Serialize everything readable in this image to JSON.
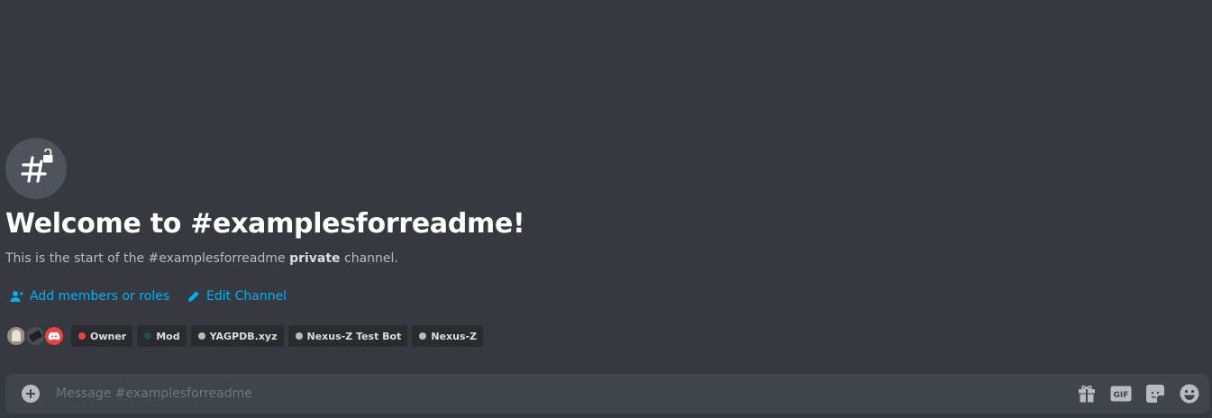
{
  "welcome": {
    "channel_icon": "hashtag-lock-icon",
    "title": "Welcome to #examplesforreadme!",
    "desc_prefix": "This is the start of the #examplesforreadme ",
    "desc_bold": "private",
    "desc_suffix": " channel."
  },
  "actions": {
    "add_members_label": "Add members or roles",
    "add_members_icon": "person-add-icon",
    "edit_channel_label": "Edit Channel",
    "edit_channel_icon": "pencil-icon"
  },
  "members": {
    "avatars": [
      "user-avatar",
      "user-avatar",
      "discord-logo-avatar"
    ],
    "roles": [
      {
        "name": "Owner",
        "color": "#ed4245"
      },
      {
        "name": "Mod",
        "color": "#1f4d58"
      },
      {
        "name": "YAGPDB.xyz",
        "color": "#b9bbbe"
      },
      {
        "name": "Nexus-Z Test Bot",
        "color": "#b9bbbe"
      },
      {
        "name": "Nexus-Z",
        "color": "#b9bbbe"
      }
    ]
  },
  "composer": {
    "placeholder": "Message #examplesforreadme",
    "value": "",
    "attach_icon": "plus-circle-icon",
    "buttons": [
      "gift-icon",
      "gif-icon",
      "sticker-icon",
      "emoji-icon"
    ]
  },
  "colors": {
    "background": "#36393f",
    "link": "#00aff4",
    "composer_bg": "#40444b",
    "role_bg": "#292b2f"
  }
}
